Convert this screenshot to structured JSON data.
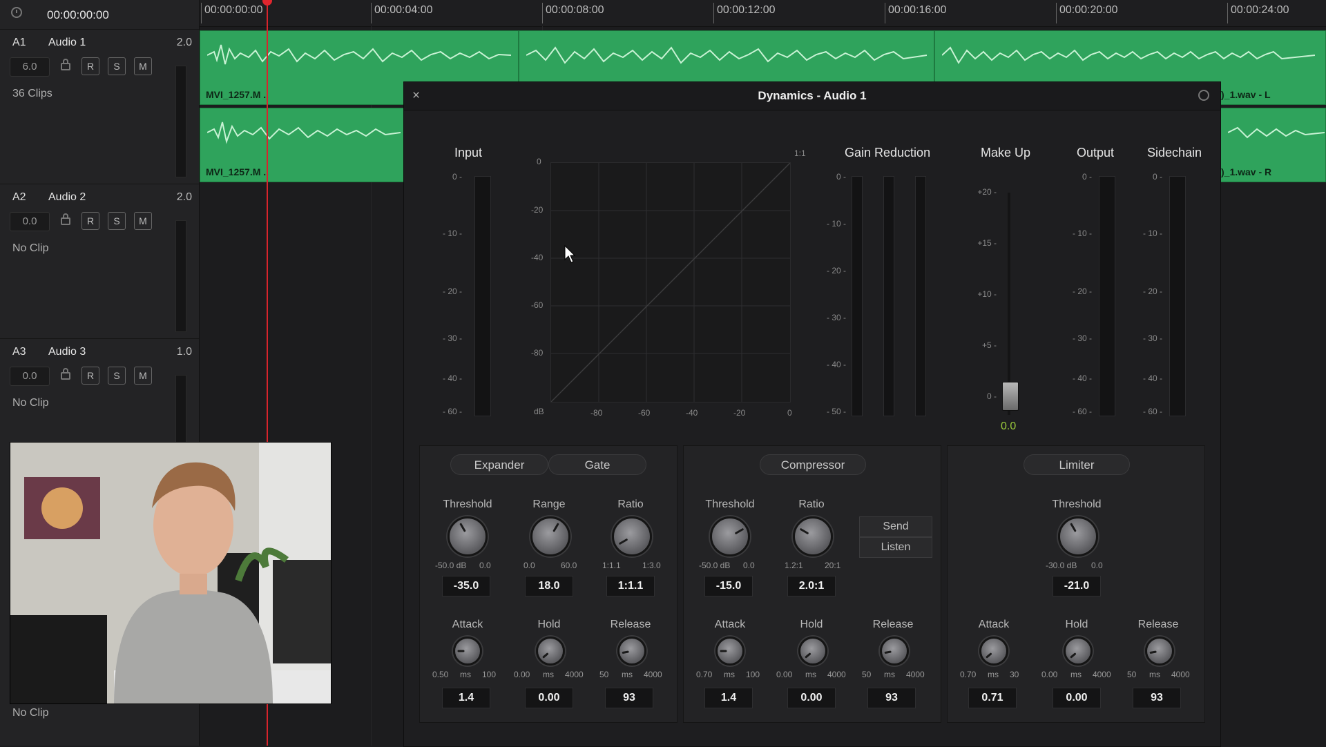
{
  "timeline": {
    "timecode": "00:00:00:00",
    "ruler": [
      "00:00:00:00",
      "00:00:04:00",
      "00:00:08:00",
      "00:00:12:00",
      "00:00:16:00",
      "00:00:20:00",
      "00:00:24:00"
    ]
  },
  "tracks": [
    {
      "id": "A1",
      "name": "Audio 1",
      "gain": "2.0",
      "volume": "6.0",
      "clips": "36 Clips",
      "r": "R",
      "s": "S",
      "m": "M"
    },
    {
      "id": "A2",
      "name": "Audio 2",
      "gain": "2.0",
      "volume": "0.0",
      "clips": "No Clip",
      "r": "R",
      "s": "S",
      "m": "M"
    },
    {
      "id": "A3",
      "name": "Audio 3",
      "gain": "1.0",
      "volume": "0.0",
      "clips": "No Clip",
      "r": "R",
      "s": "S",
      "m": "M"
    }
  ],
  "last_track_clips": "No Clip",
  "clips": {
    "left_top": "MVI_1257.M ..",
    "left_bottom": "MVI_1257.M ..",
    "right_top": ")_1.wav - L",
    "right_bottom": ")_1.wav - R"
  },
  "dynamics": {
    "title": "Dynamics - Audio 1",
    "close": "×",
    "sections": {
      "input": "Input",
      "gain_reduction": "Gain Reduction",
      "make_up": "Make Up",
      "output": "Output",
      "sidechain": "Sidechain"
    },
    "meter_ticks": [
      "0 -",
      "- 10 -",
      "- 20 -",
      "- 30 -",
      "- 40 -",
      "- 60 -"
    ],
    "gr_ticks": [
      "0 -",
      "- 10 -",
      "- 20 -",
      "- 30 -",
      "- 40 -",
      "- 50 -"
    ],
    "makeup_ticks": [
      "+20 -",
      "+15 -",
      "+10 -",
      "+5 -",
      "0 -"
    ],
    "makeup_value": "0.0",
    "graph_y": [
      "0",
      "-20",
      "-40",
      "-60",
      "-80"
    ],
    "graph_x": [
      "dB",
      "-80",
      "-60",
      "-40",
      "-20",
      "0"
    ],
    "graph_ratio": "1:1",
    "expander_tab": "Expander",
    "gate_tab": "Gate",
    "compressor_tab": "Compressor",
    "limiter_tab": "Limiter",
    "send": "Send",
    "listen": "Listen",
    "expander": {
      "threshold": {
        "label": "Threshold",
        "min": "-50.0 dB",
        "max": "0.0",
        "value": "-35.0"
      },
      "range": {
        "label": "Range",
        "min": "0.0",
        "max": "60.0",
        "value": "18.0"
      },
      "ratio": {
        "label": "Ratio",
        "min": "1:1.1",
        "max": "1:3.0",
        "value": "1:1.1"
      },
      "attack": {
        "label": "Attack",
        "min": "0.50",
        "unit": "ms",
        "max": "100",
        "value": "1.4"
      },
      "hold": {
        "label": "Hold",
        "min": "0.00",
        "unit": "ms",
        "max": "4000",
        "value": "0.00"
      },
      "release": {
        "label": "Release",
        "min": "50",
        "unit": "ms",
        "max": "4000",
        "value": "93"
      }
    },
    "compressor": {
      "threshold": {
        "label": "Threshold",
        "min": "-50.0 dB",
        "max": "0.0",
        "value": "-15.0"
      },
      "ratio": {
        "label": "Ratio",
        "min": "1.2:1",
        "max": "20:1",
        "value": "2.0:1"
      },
      "attack": {
        "label": "Attack",
        "min": "0.70",
        "unit": "ms",
        "max": "100",
        "value": "1.4"
      },
      "hold": {
        "label": "Hold",
        "min": "0.00",
        "unit": "ms",
        "max": "4000",
        "value": "0.00"
      },
      "release": {
        "label": "Release",
        "min": "50",
        "unit": "ms",
        "max": "4000",
        "value": "93"
      }
    },
    "limiter": {
      "threshold": {
        "label": "Threshold",
        "min": "-30.0 dB",
        "max": "0.0",
        "value": "-21.0"
      },
      "attack": {
        "label": "Attack",
        "min": "0.70",
        "unit": "ms",
        "max": "30",
        "value": "0.71"
      },
      "hold": {
        "label": "Hold",
        "min": "0.00",
        "unit": "ms",
        "max": "4000",
        "value": "0.00"
      },
      "release": {
        "label": "Release",
        "min": "50",
        "unit": "ms",
        "max": "4000",
        "value": "93"
      }
    }
  },
  "colors": {
    "clip_green": "#2fa35c",
    "playhead": "#d8242c",
    "makeup_value": "#9ccc3c"
  }
}
